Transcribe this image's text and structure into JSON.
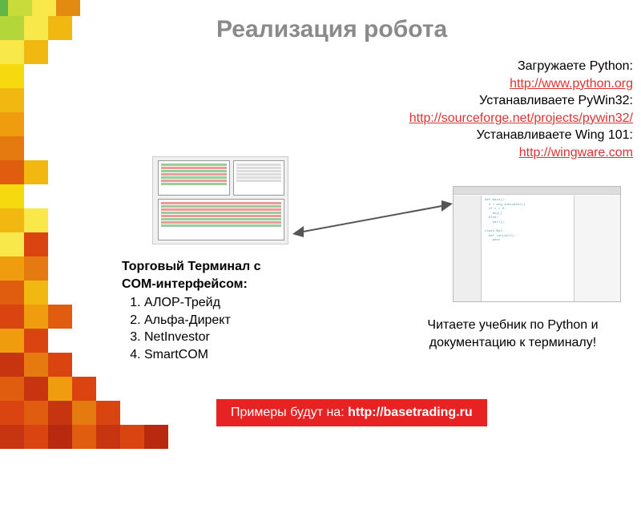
{
  "title": "Реализация робота",
  "right_block": {
    "line1": "Загружаете Python:",
    "link1": "http://www.python.org",
    "line2": "Устанавливаете PyWin32:",
    "link2": "http://sourceforge.net/projects/pywin32/",
    "line3": "Устанавливаете Wing 101:",
    "link3": "http://wingware.com"
  },
  "left_block": {
    "heading1": "Торговый Терминал с",
    "heading2": "COM-интерфейсом:",
    "items": [
      "АЛОР-Трейд",
      "Альфа-Директ",
      "NetInvestor",
      "SmartCOM"
    ]
  },
  "bottom_text1": "Читаете учебник по Python и",
  "bottom_text2": "документацию к терминалу!",
  "banner_prefix": "Примеры будут на: ",
  "banner_url": "http://basetrading.ru"
}
